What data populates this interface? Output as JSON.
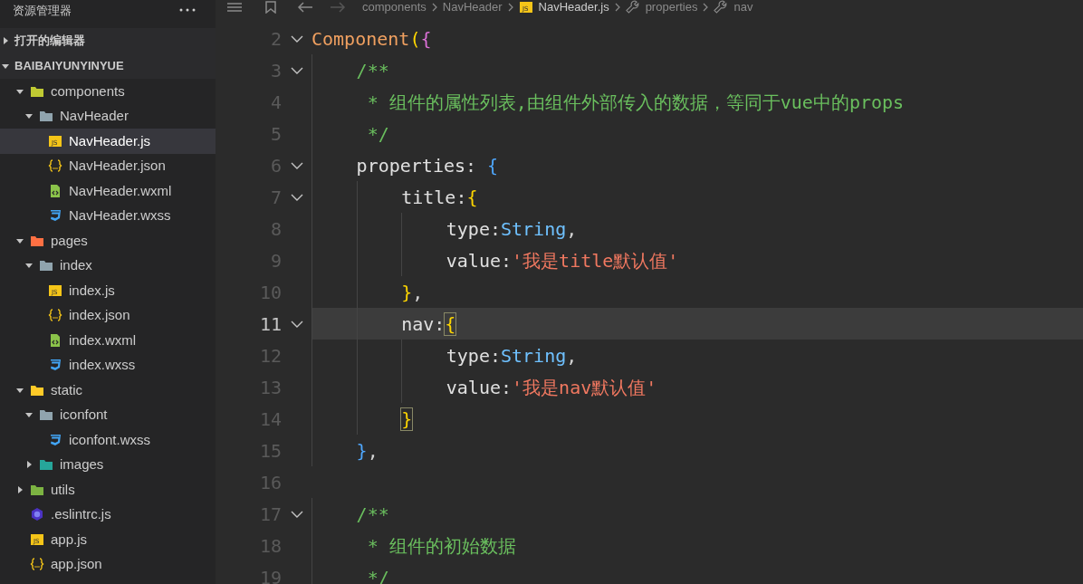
{
  "sidebar": {
    "title": "资源管理器",
    "sections": [
      {
        "label": "打开的编辑器",
        "expanded": false
      },
      {
        "label": "BAIBAIYUNYINYUE",
        "expanded": true
      }
    ],
    "tree": [
      {
        "name": "components",
        "kind": "folder",
        "color": "#c0ca33",
        "expanded": true,
        "selected": false,
        "children": [
          {
            "name": "NavHeader",
            "kind": "folder",
            "color": "#90a4ae",
            "expanded": true,
            "selected": false,
            "children": [
              {
                "name": "NavHeader.js",
                "kind": "script",
                "badge": "JS",
                "selected": true
              },
              {
                "name": "NavHeader.json",
                "kind": "data",
                "selected": false
              },
              {
                "name": "NavHeader.wxml",
                "kind": "markup",
                "selected": false
              },
              {
                "name": "NavHeader.wxss",
                "kind": "style",
                "selected": false
              }
            ]
          }
        ]
      },
      {
        "name": "pages",
        "kind": "folder",
        "color": "#ff7043",
        "expanded": true,
        "selected": false,
        "children": [
          {
            "name": "index",
            "kind": "folder",
            "color": "#90a4ae",
            "expanded": true,
            "selected": false,
            "children": [
              {
                "name": "index.js",
                "kind": "script",
                "badge": "JS",
                "selected": false
              },
              {
                "name": "index.json",
                "kind": "data",
                "selected": false
              },
              {
                "name": "index.wxml",
                "kind": "markup",
                "selected": false
              },
              {
                "name": "index.wxss",
                "kind": "style",
                "selected": false
              }
            ]
          }
        ]
      },
      {
        "name": "static",
        "kind": "folder",
        "color": "#ffca28",
        "expanded": true,
        "selected": false,
        "children": [
          {
            "name": "iconfont",
            "kind": "folder",
            "color": "#90a4ae",
            "expanded": true,
            "selected": false,
            "children": [
              {
                "name": "iconfont.wxss",
                "kind": "style",
                "selected": false
              }
            ]
          },
          {
            "name": "images",
            "kind": "folder",
            "color": "#26a69a",
            "expanded": false,
            "selected": false
          }
        ]
      },
      {
        "name": "utils",
        "kind": "folder",
        "color": "#7cb342",
        "expanded": false,
        "selected": false
      },
      {
        "name": ".eslintrc.js",
        "kind": "lint",
        "selected": false
      },
      {
        "name": "app.js",
        "kind": "script",
        "badge": "JS",
        "selected": false
      },
      {
        "name": "app.json",
        "kind": "data",
        "selected": false
      }
    ]
  },
  "breadcrumb": [
    {
      "label": "components"
    },
    {
      "label": "NavHeader"
    },
    {
      "label": "NavHeader.js",
      "kind": "script",
      "badge": "JS"
    },
    {
      "label": "properties",
      "kind": "symbol"
    },
    {
      "label": "nav",
      "kind": "symbol"
    }
  ],
  "editor": {
    "lines": [
      {
        "number": "2",
        "fold": true,
        "current": false,
        "tokens": [
          {
            "kind": "function",
            "text": "Component"
          },
          {
            "kind": "bracket1",
            "text": "("
          },
          {
            "kind": "bracket2",
            "text": "{"
          }
        ]
      },
      {
        "number": "3",
        "fold": true,
        "current": false,
        "tokens": [
          {
            "kind": "comment",
            "text": "    /**"
          }
        ]
      },
      {
        "number": "4",
        "fold": false,
        "current": false,
        "tokens": [
          {
            "kind": "comment",
            "text": "     * 组件的属性列表,由组件外部传入的数据，等同于vue中的props"
          }
        ]
      },
      {
        "number": "5",
        "fold": false,
        "current": false,
        "tokens": [
          {
            "kind": "comment",
            "text": "     */"
          }
        ]
      },
      {
        "number": "6",
        "fold": true,
        "current": false,
        "tokens": [
          {
            "kind": "property",
            "text": "    properties"
          },
          {
            "kind": "plain",
            "text": ": "
          },
          {
            "kind": "bracket3",
            "text": "{"
          }
        ]
      },
      {
        "number": "7",
        "fold": true,
        "current": false,
        "tokens": [
          {
            "kind": "property",
            "text": "        title"
          },
          {
            "kind": "plain",
            "text": ":"
          },
          {
            "kind": "bracket1",
            "text": "{"
          }
        ]
      },
      {
        "number": "8",
        "fold": false,
        "current": false,
        "tokens": [
          {
            "kind": "property",
            "text": "            type"
          },
          {
            "kind": "plain",
            "text": ":"
          },
          {
            "kind": "type",
            "text": "String"
          },
          {
            "kind": "plain",
            "text": ","
          }
        ]
      },
      {
        "number": "9",
        "fold": false,
        "current": false,
        "tokens": [
          {
            "kind": "property",
            "text": "            value"
          },
          {
            "kind": "plain",
            "text": ":"
          },
          {
            "kind": "string",
            "text": "'我是title默认值'"
          }
        ]
      },
      {
        "number": "10",
        "fold": false,
        "current": false,
        "tokens": [
          {
            "kind": "bracket1",
            "text": "        }"
          },
          {
            "kind": "plain",
            "text": ","
          }
        ]
      },
      {
        "number": "11",
        "fold": true,
        "current": true,
        "tokens": [
          {
            "kind": "property",
            "text": "        nav"
          },
          {
            "kind": "plain",
            "text": ":"
          },
          {
            "kind": "bracket1",
            "text": "{",
            "matched": true
          }
        ]
      },
      {
        "number": "12",
        "fold": false,
        "current": false,
        "tokens": [
          {
            "kind": "property",
            "text": "            type"
          },
          {
            "kind": "plain",
            "text": ":"
          },
          {
            "kind": "type",
            "text": "String"
          },
          {
            "kind": "plain",
            "text": ","
          }
        ]
      },
      {
        "number": "13",
        "fold": false,
        "current": false,
        "tokens": [
          {
            "kind": "property",
            "text": "            value"
          },
          {
            "kind": "plain",
            "text": ":"
          },
          {
            "kind": "string",
            "text": "'我是nav默认值'"
          }
        ]
      },
      {
        "number": "14",
        "fold": false,
        "current": false,
        "tokens": [
          {
            "kind": "bracket1",
            "text": "        }",
            "matched": true
          }
        ]
      },
      {
        "number": "15",
        "fold": false,
        "current": false,
        "tokens": [
          {
            "kind": "bracket3",
            "text": "    }"
          },
          {
            "kind": "plain",
            "text": ","
          }
        ]
      },
      {
        "number": "16",
        "fold": false,
        "current": false
      },
      {
        "number": "17",
        "fold": true,
        "current": false,
        "tokens": [
          {
            "kind": "comment",
            "text": "    /**"
          }
        ]
      },
      {
        "number": "18",
        "fold": false,
        "current": false,
        "tokens": [
          {
            "kind": "comment",
            "text": "     * 组件的初始数据"
          }
        ]
      },
      {
        "number": "19",
        "fold": false,
        "current": false,
        "tokens": [
          {
            "kind": "comment",
            "text": "     */"
          }
        ]
      }
    ]
  }
}
